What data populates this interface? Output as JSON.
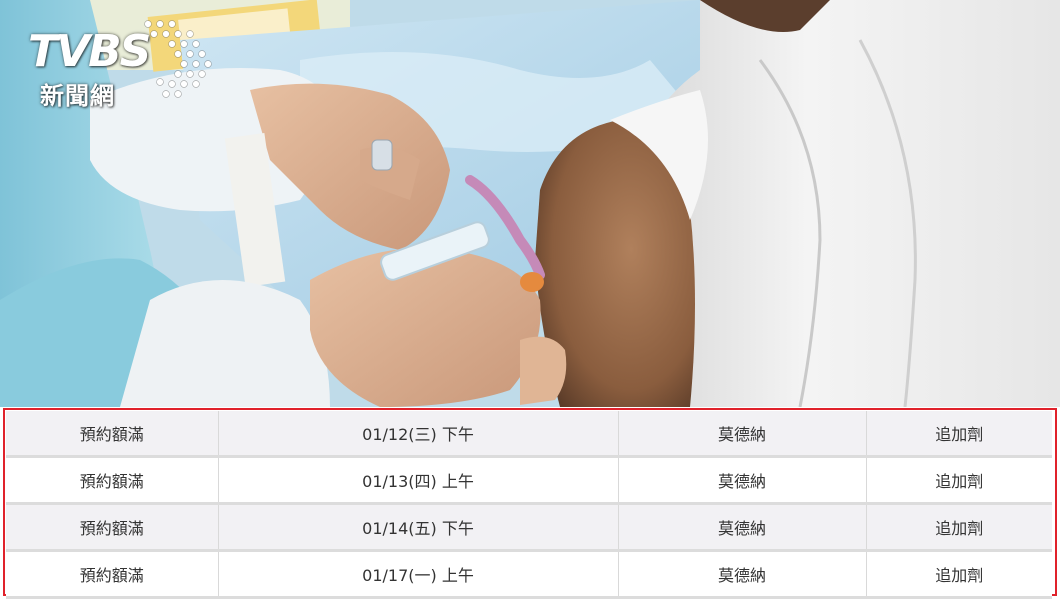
{
  "logo": {
    "main": "TVBS",
    "sub": "新聞網"
  },
  "slots": {
    "rows": [
      {
        "status": "預約額滿",
        "datetime": "01/12(三) 下午",
        "vaccine": "莫德納",
        "dose": "追加劑"
      },
      {
        "status": "預約額滿",
        "datetime": "01/13(四) 上午",
        "vaccine": "莫德納",
        "dose": "追加劑"
      },
      {
        "status": "預約額滿",
        "datetime": "01/14(五) 下午",
        "vaccine": "莫德納",
        "dose": "追加劑"
      },
      {
        "status": "預約額滿",
        "datetime": "01/17(一) 上午",
        "vaccine": "莫德納",
        "dose": "追加劑"
      }
    ]
  },
  "colors": {
    "frame": "#e0222b",
    "row_shade": "#f2f1f4"
  }
}
